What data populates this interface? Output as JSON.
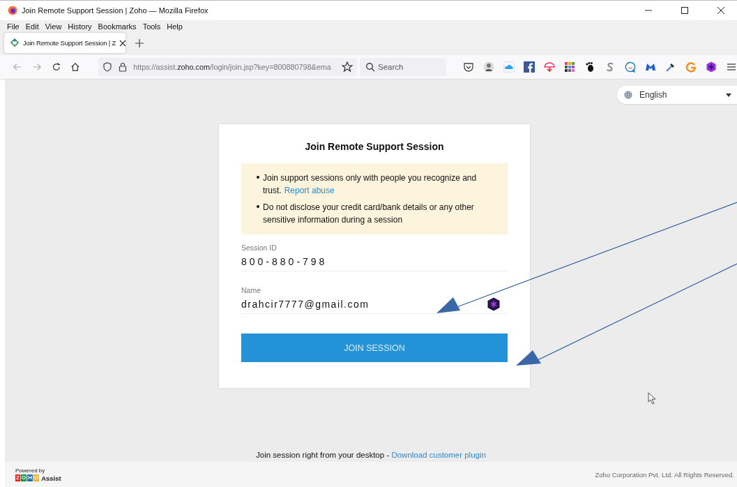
{
  "window": {
    "title": "Join Remote Support Session | Zoho — Mozilla Firefox"
  },
  "menu": [
    "File",
    "Edit",
    "View",
    "History",
    "Bookmarks",
    "Tools",
    "Help"
  ],
  "tabs": [
    {
      "label": "Join Remote Support Session | Z",
      "selected": true
    }
  ],
  "address_bar": {
    "url_start": "https://assist.",
    "url_domain": "zoho.com",
    "url_rest": "/login/join.jsp?key=800880798&ema"
  },
  "search": {
    "placeholder": "Search"
  },
  "language": {
    "value": "English"
  },
  "card": {
    "title": "Join Remote Support Session",
    "notices": [
      {
        "text": "Join support sessions only with people you recognize and trust.",
        "link": "Report abuse"
      },
      {
        "text": "Do not disclose your credit card/bank details or any other sensitive information during a session"
      }
    ],
    "fields": [
      {
        "label": "Session ID",
        "value": "800-880-798"
      },
      {
        "label": "Name",
        "value": "drahcir7777@gmail.com"
      }
    ],
    "button": "JOIN SESSION"
  },
  "footer": {
    "text": "Join session right from your desktop -",
    "link": "Download customer plugin",
    "powered_by": "Powered by",
    "logo": [
      "Z",
      "O",
      "H",
      "O"
    ],
    "product": "Assist",
    "copyright": "Zoho Corporation Pvt. Ltd. All Rights Reserved."
  }
}
